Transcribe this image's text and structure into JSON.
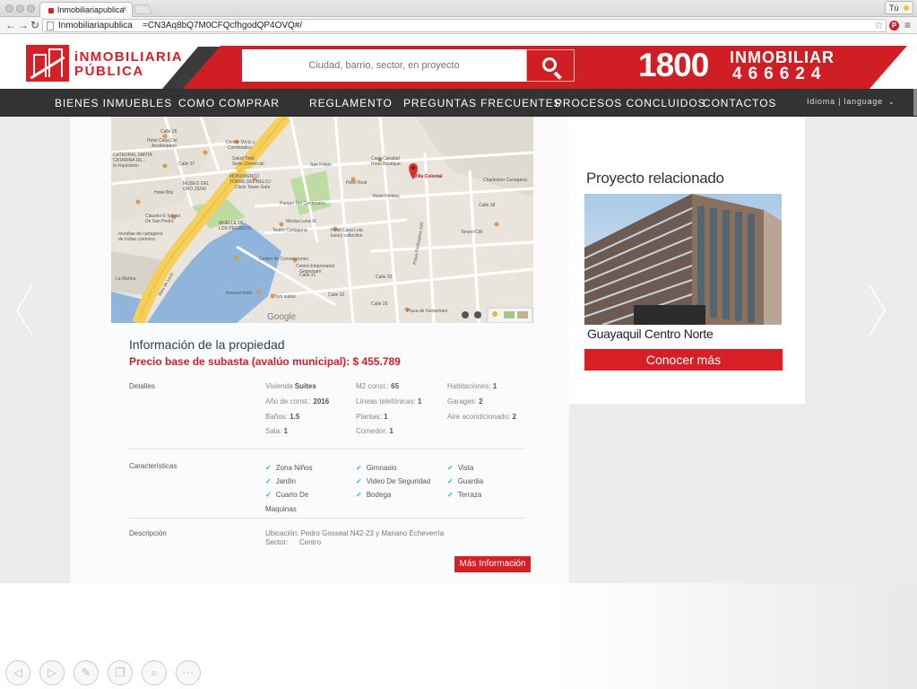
{
  "browser": {
    "tab_title": "Inmobiliariapublica",
    "url_part1": "Inmobiliariapublica",
    "url_part2": "=CN3Aq8bQ7M0CFQcfhgodQP4OVQ#/",
    "profile_label": "Tú"
  },
  "header": {
    "logo_line1": "iNMOBILIARIA",
    "logo_line2": "PÚBLICA",
    "search_placeholder": "Ciudad, barrio, sector, en proyecto",
    "phone_number": "1800",
    "phone_word": "INMOBILIAR",
    "phone_digits": "466624"
  },
  "nav": {
    "items": [
      "BIENES INMUEBLES",
      "COMO COMPRAR",
      "REGLAMENTO",
      "PREGUNTAS FRECUENTES",
      "PROCESOS CONCLUIDOS",
      "CONTACTOS"
    ],
    "language": "Idioma | language"
  },
  "map": {
    "marker_label": "Villa Colonial",
    "logo": "Google",
    "labels": [
      "Calle 35",
      "Hotel Casa Del Arzobispado",
      "Centro Médico Comfenalco",
      "Salud Total Sede Comercial",
      "CATEDRAL SANTA CATARINA DE... la Inquisicion",
      "Calle 37",
      "San Felipe",
      "Casa Canabal Hotel Boutique",
      "MUSEO DEL ORO ZENU",
      "MONUMENTO TORRE DEL RELOJ",
      "Clock Tower Gate",
      "Hotel Real",
      "Hotel Holiday",
      "Charleston Cartagena",
      "Hotel Bitz",
      "Parque Del Centenario",
      "Claustro E Iglesia De San Pedro",
      "MUELLE DE LOS PEGASOS",
      "Teatro Cartagena",
      "Hotel Casa Lola luxury collection",
      "Centro de Convenciones",
      "Centro Empresarial Getsemaní",
      "Arsenal hotel",
      "Tom suites",
      "Calle 29",
      "Calle 30",
      "Calle 31",
      "Calle 32",
      "Calle 38",
      "Tenpel CW",
      "Blas de Lezo",
      "Playa Pedregosa 10C",
      "Plaza de Getsemaní",
      "La Marina",
      "murallas de cartagena de indias contorno",
      "Mecha Luna St"
    ]
  },
  "property": {
    "title": "Información de la propiedad",
    "price": "Precio base de subasta (avalúo municipal): $ 455.789",
    "detalles_label": "Detalles",
    "details": [
      {
        "k": "Vivienda",
        "v": "Suites"
      },
      {
        "k": "M2 const.:",
        "v": "65"
      },
      {
        "k": "Habitaciones:",
        "v": "1"
      },
      {
        "k": "Año de const.:",
        "v": "2016"
      },
      {
        "k": "Líneas telefónicas:",
        "v": "1"
      },
      {
        "k": "Garages:",
        "v": "2"
      },
      {
        "k": "Baños:",
        "v": "1.5"
      },
      {
        "k": "Plantas:",
        "v": "1"
      },
      {
        "k": "Aire acondicionado:",
        "v": "2"
      },
      {
        "k": "Sala:",
        "v": "1"
      },
      {
        "k": "Comedor:",
        "v": "1"
      }
    ],
    "caracteristicas_label": "Características",
    "features": [
      "Zona Niños",
      "Gimnasio",
      "Vista",
      "Jardín",
      "Video De Seguridad",
      "Guardia",
      "Cuarto De",
      "Bodega",
      "Terraza"
    ],
    "features_overflow": "Maquinas",
    "descripcion_label": "Descripción",
    "ubicacion": "Ubicación: Pedro Gosseal N42-23 y Mariano Echeverría",
    "sector_label": "Sector:",
    "sector_value": "Centro",
    "more_button": "Más Información"
  },
  "related": {
    "title": "Proyecto relacionado",
    "name": "Guayaquil Centro Norte",
    "button": "Conocer más"
  },
  "colors": {
    "brand_red": "#d71f26",
    "nav_dark": "#333333",
    "check_teal": "#2bb5b5"
  }
}
